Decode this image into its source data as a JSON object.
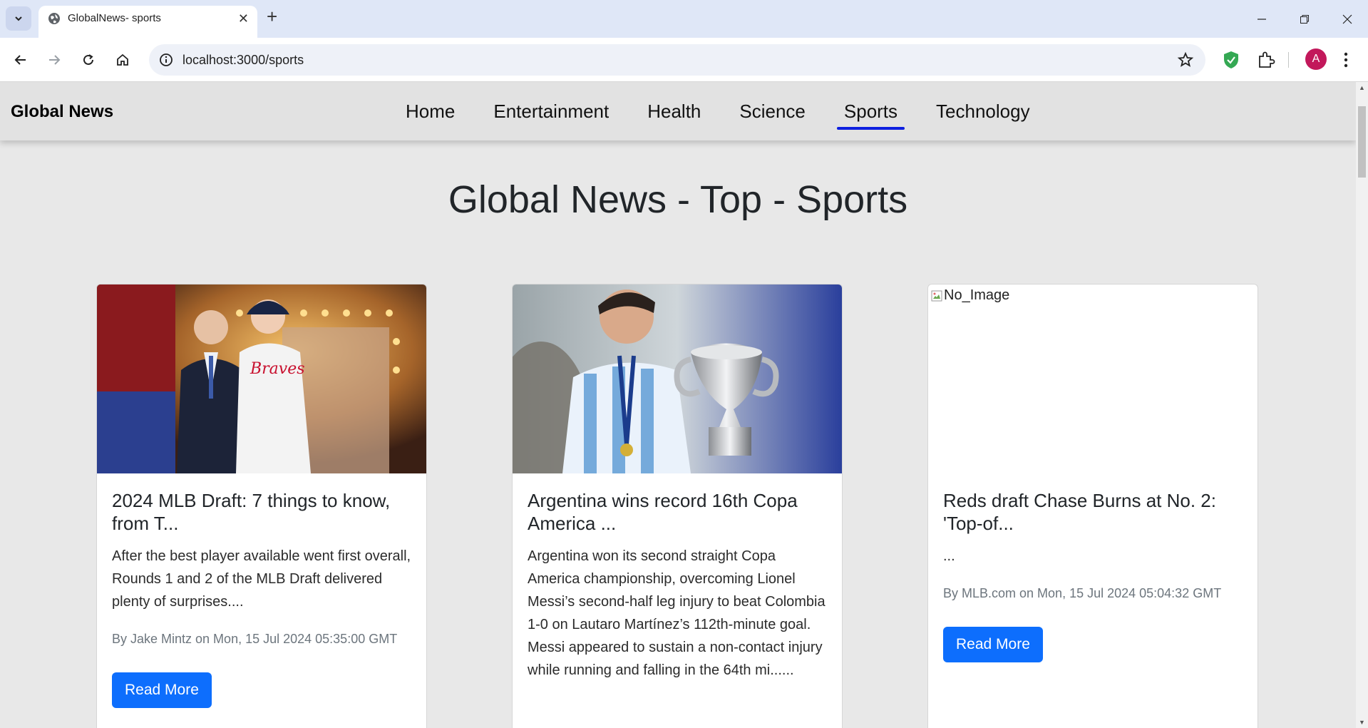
{
  "browser": {
    "tab_title": "GlobalNews- sports",
    "url": "localhost:3000/sports",
    "avatar_letter": "A"
  },
  "navbar": {
    "brand": "Global News",
    "links": [
      "Home",
      "Entertainment",
      "Health",
      "Science",
      "Sports",
      "Technology"
    ],
    "active": "Sports",
    "accent": "#0d1fe0"
  },
  "page": {
    "title": "Global News - Top - Sports"
  },
  "cards": [
    {
      "title": "2024 MLB Draft: 7 things to know, from T...",
      "description": "After the best player available went first overall, Rounds 1 and 2 of the MLB Draft delivered plenty of surprises....",
      "meta": "By Jake Mintz on Mon, 15 Jul 2024 05:35:00 GMT",
      "button": "Read More"
    },
    {
      "title": "Argentina wins record 16th Copa America ...",
      "description": "Argentina won its second straight Copa America championship, overcoming Lionel Messi’s second-half leg injury to beat Colombia 1-0 on Lautaro Martínez’s 112th-minute goal. Messi appeared to sustain a non-contact injury while running and falling in the 64th mi......",
      "meta": "",
      "button": "Read More"
    },
    {
      "image_alt": "No_Image",
      "title": "Reds draft Chase Burns at No. 2: 'Top-of...",
      "description": "...",
      "meta": "By MLB.com on Mon, 15 Jul 2024 05:04:32 GMT",
      "button": "Read More"
    }
  ],
  "colors": {
    "button": "#0d6efd",
    "page_bg": "#e8e8e8"
  }
}
